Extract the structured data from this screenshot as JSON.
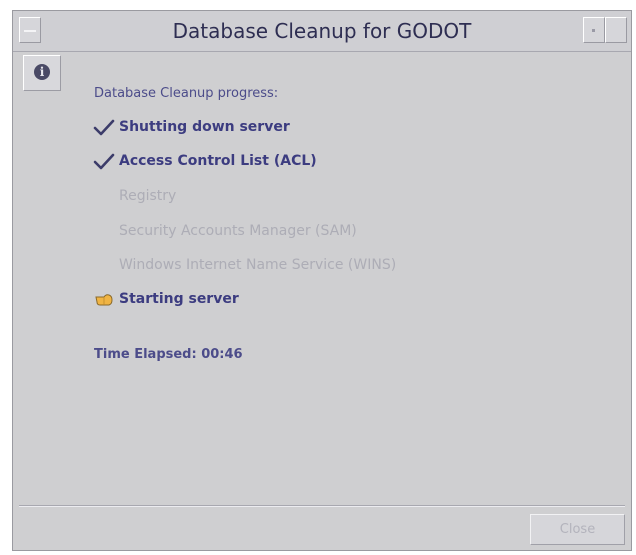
{
  "window": {
    "title": "Database Cleanup for GODOT"
  },
  "info_button": {
    "glyph": "i"
  },
  "progress": {
    "heading": "Database Cleanup progress:",
    "steps": [
      {
        "label": "Shutting down server",
        "status": "done",
        "icon": "checkmark-icon"
      },
      {
        "label": "Access Control List (ACL)",
        "status": "done",
        "icon": "checkmark-icon"
      },
      {
        "label": "Registry",
        "status": "pending"
      },
      {
        "label": "Security Accounts Manager (SAM)",
        "status": "pending"
      },
      {
        "label": "Windows Internet Name Service (WINS)",
        "status": "pending"
      },
      {
        "label": "Starting server",
        "status": "in-progress",
        "icon": "pointing-hand-icon"
      }
    ],
    "time_elapsed": "Time Elapsed: 00:46"
  },
  "footer": {
    "close_label": "Close",
    "close_enabled": false
  },
  "colors": {
    "window_bg": "#cfcfd1",
    "done_text": "#3c3c80",
    "pending_text": "#adadb6",
    "title_text": "#2e2e52"
  }
}
